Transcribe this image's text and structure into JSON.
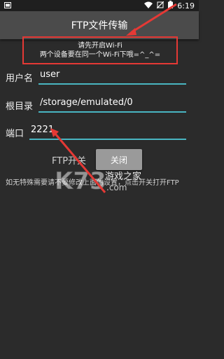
{
  "status_bar": {
    "time": "6:19",
    "icons": [
      "sim-card-icon",
      "wifi-icon",
      "no-sim-icon",
      "battery-icon"
    ]
  },
  "app_bar": {
    "title": "FTP文件传输"
  },
  "notice": {
    "line1": "请先开启Wi-Fi",
    "line2": "两个设备要在同一个Wi-Fi下哦=^_^="
  },
  "form": {
    "username_label": "用户名",
    "username_value": "user",
    "root_label": "根目录",
    "root_value": "/storage/emulated/0",
    "port_label": "端口",
    "port_value": "2221"
  },
  "ftp": {
    "switch_label": "FTP开关",
    "button_label": "关闭"
  },
  "hint": "如无特殊需要请不要修改上面的设置，点击开关打开FTP",
  "watermark": {
    "text": "K73游戏之家",
    "domain": ".com"
  },
  "colors": {
    "background": "#2b2b2b",
    "app_bar": "#4b4b4b",
    "accent": "#49b6c2",
    "annotation": "#e53935"
  }
}
